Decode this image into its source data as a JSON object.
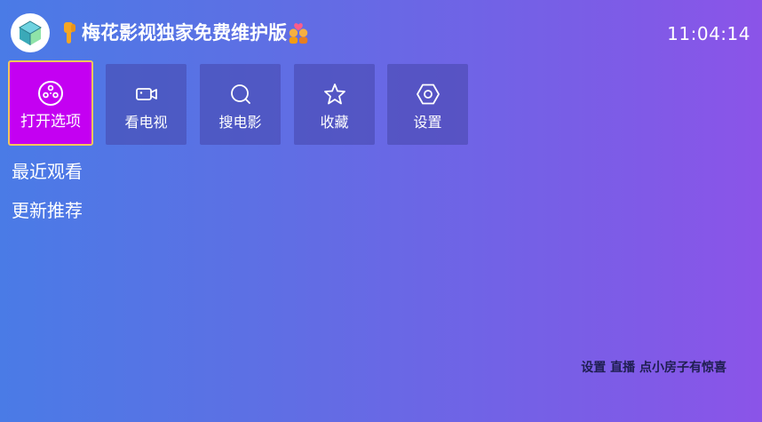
{
  "header": {
    "app_title": "梅花影视独家免费维护版",
    "time": "11:04:14",
    "title_leading_icon": "pointing-down-hand-emoji",
    "title_trailing_icon": "couple-with-heart-emoji",
    "logo_icon": "app-cube-logo"
  },
  "menu": {
    "items": [
      {
        "label": "打开选项",
        "icon": "film-reel-icon",
        "active": true
      },
      {
        "label": "看电视",
        "icon": "video-camera-icon",
        "active": false
      },
      {
        "label": "搜电影",
        "icon": "search-icon",
        "active": false
      },
      {
        "label": "收藏",
        "icon": "star-icon",
        "active": false
      },
      {
        "label": "设置",
        "icon": "hexagon-settings-icon",
        "active": false
      }
    ]
  },
  "sections": {
    "recent": "最近观看",
    "updates": "更新推荐"
  },
  "footer": {
    "hint": "设置 直播  点小房子有惊喜"
  },
  "colors": {
    "background_start": "#4a7be6",
    "background_end": "#8b54e8",
    "active_tile": "#c400f2",
    "active_border": "#f4c65b",
    "hint_text": "#1e1e50"
  }
}
